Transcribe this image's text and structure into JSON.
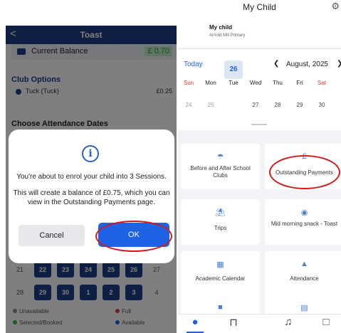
{
  "left": {
    "back_glyph": "<",
    "title": "Toast",
    "balance": {
      "label": "Current Balance",
      "value": "£ 0.70"
    },
    "club_options": {
      "heading": "Club Options",
      "item": {
        "name": "Tuck (Tuck)",
        "price": "£0.25"
      }
    },
    "choose_dates_heading": "Choose Attendance Dates",
    "calendar_rows": [
      [
        "21",
        "22",
        "23",
        "24",
        "25",
        "26",
        "27"
      ],
      [
        "28",
        "29",
        "30",
        "1",
        "2",
        "3",
        "4"
      ]
    ],
    "legend": [
      {
        "label": "Unavailable",
        "color": "#8f8f8f"
      },
      {
        "label": "Full",
        "color": "#e23a3a"
      },
      {
        "label": "Selected/Booked",
        "color": "#3cb54a"
      },
      {
        "label": "Available",
        "color": "#1e63e6"
      }
    ],
    "dialog": {
      "icon": "info-icon",
      "message1": "You're about to enrol your child into 3 Sessions.",
      "message2": "This will create a balance of £0.75, which you can view in the Outstanding Payments page.",
      "cancel_label": "Cancel",
      "ok_label": "OK"
    }
  },
  "right": {
    "title": "My Child",
    "child": {
      "name": "My child",
      "school": "Arnold Mill Primary"
    },
    "calendar": {
      "today_label": "Today",
      "month": "August, 2025",
      "weekdays": [
        "Sun",
        "Mon",
        "Tue",
        "Wed",
        "Thu",
        "Fri",
        "Sat"
      ],
      "dates": [
        "24",
        "25",
        "26",
        "27",
        "28",
        "29",
        "30"
      ],
      "today_date": "26"
    },
    "tiles": [
      {
        "label": "Before and After School Clubs",
        "icon": "clubs-icon"
      },
      {
        "label": "Outstanding Payments",
        "icon": "payments-icon"
      },
      {
        "label": "Trips",
        "icon": "trips-icon"
      },
      {
        "label": "Mid morning snack - Toast",
        "icon": "snack-icon"
      },
      {
        "label": "Academic Calendar",
        "icon": "calendar-icon"
      },
      {
        "label": "Attendance",
        "icon": "attendance-icon"
      },
      {
        "label": "",
        "icon": "more-icon"
      },
      {
        "label": "",
        "icon": "document-icon"
      }
    ],
    "nav": [
      "person-icon",
      "bag-icon",
      "bell-icon",
      "chat-icon"
    ]
  },
  "colors": {
    "brand": "#1f3f86",
    "accent": "#1e63e6",
    "highlight_ring": "#d31a1a",
    "weekend": "#e23a3a"
  }
}
